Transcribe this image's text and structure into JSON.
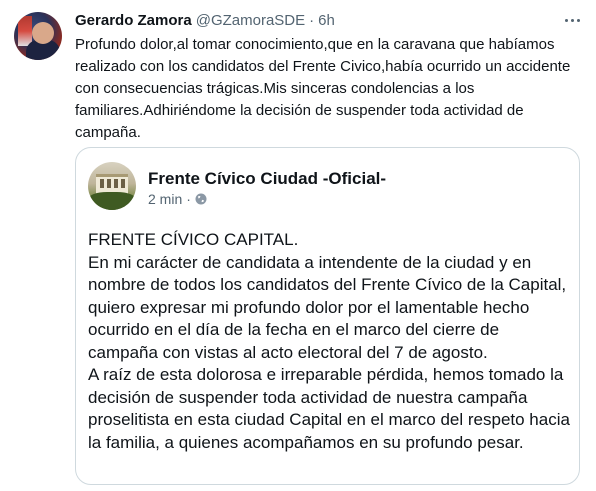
{
  "tweet": {
    "author_name": "Gerardo Zamora",
    "author_handle": "@GZamoraSDE",
    "separator": "·",
    "timestamp": "6h",
    "text": "Profundo dolor,al tomar  conocimiento,que en la caravana que habíamos realizado con los candidatos del Frente Civico,había ocurrido un accidente con consecuencias trágicas.Mis sinceras condolencias a los familiares.Adhiriéndome  la decisión de suspender toda actividad de campaña."
  },
  "quote": {
    "author_name": "Frente Cívico Ciudad -Oficial-",
    "timestamp": "2 min",
    "separator": "·",
    "visibility_icon": "globe-icon",
    "text": "FRENTE CÍVICO CAPITAL.\nEn mi carácter de candidata a intendente de la ciudad y en nombre de todos los candidatos del Frente Cívico de la Capital, quiero expresar mi profundo dolor por el lamentable hecho ocurrido en el día de la fecha en el marco del cierre de campaña con vistas al acto electoral del 7 de agosto.\nA raíz de esta dolorosa e irreparable pérdida, hemos tomado la decisión de suspender toda actividad de nuestra campaña proselitista en esta ciudad Capital en el marco del respeto hacia la familia, a quienes acompañamos en su profundo pesar."
  },
  "icons": {
    "more": "more-horizontal-icon"
  },
  "colors": {
    "text_primary": "#0f1419",
    "text_secondary": "#536471",
    "border": "#cfd9de",
    "background": "#ffffff"
  }
}
